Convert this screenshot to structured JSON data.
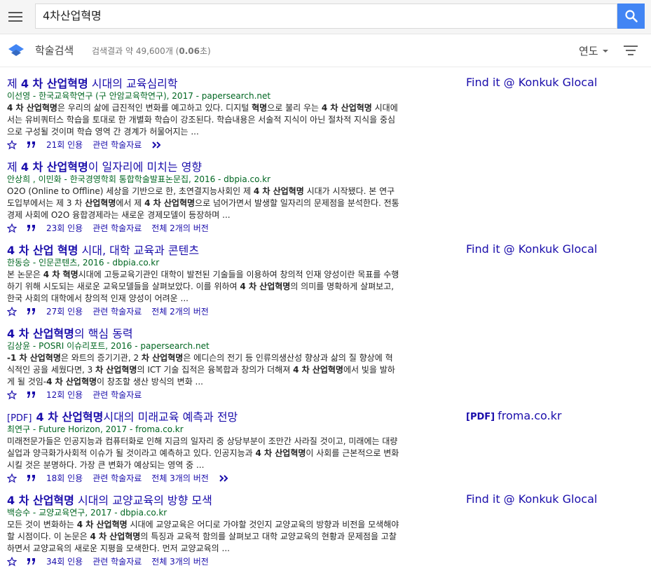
{
  "search": {
    "query": "4차산업혁명"
  },
  "header": {
    "scholar_label": "학술검색",
    "stats": "검색결과 약 49,600개 (0.06초)",
    "stats_pre": "검색결과 약 49,600개 (",
    "stats_time": "0.06",
    "stats_post": "초)",
    "year_label": "연도"
  },
  "results": [
    {
      "pdf_tag": "",
      "title_parts": [
        [
          "제 ",
          false
        ],
        [
          "4 차 산업혁명",
          true
        ],
        [
          " 시대의 교육심리학",
          false
        ]
      ],
      "meta": "이선영 - 한국교육학연구 (구 안암교육학연구), 2017 - papersearch.net",
      "snippet_parts": [
        [
          "4 차 산업혁명",
          true
        ],
        [
          "은 우리의 삶에 급진적인 변화를 예고하고 있다. 디지털 ",
          false
        ],
        [
          "혁명",
          true
        ],
        [
          "으로 불리 우는 ",
          false
        ],
        [
          "4 차 산업혁명",
          true
        ],
        [
          " 시대에서는 유비쿼터스 학습을 토대로 한 개별화 학습이 강조된다. 학습내용은 서술적 지식이 아닌 절차적 지식을 중심으로 구성될 것이며 학습 영역 간 경계가 허물어지는 ...",
          false
        ]
      ],
      "cited": "21회 인용",
      "related": "관련 학술자료",
      "versions": "",
      "more": true,
      "side_pdf": "",
      "side_link": "Find it @ Konkuk Glocal"
    },
    {
      "pdf_tag": "",
      "title_parts": [
        [
          "제 ",
          false
        ],
        [
          "4 차 산업혁명",
          true
        ],
        [
          "이 일자리에 미치는 영향",
          false
        ]
      ],
      "meta": "안상희 , 이민화 - 한국경영학회 통합학술발표논문집, 2016 - dbpia.co.kr",
      "snippet_parts": [
        [
          "O2O (Online to Offline) 세상을 기반으로 한, 초연결지능사회인 제 ",
          false
        ],
        [
          "4 차 산업혁명",
          true
        ],
        [
          " 시대가 시작됐다. 본 연구 도입부에서는 제 3 차 ",
          false
        ],
        [
          "산업혁명",
          true
        ],
        [
          "에서 제 ",
          false
        ],
        [
          "4 차 산업혁명",
          true
        ],
        [
          "으로 넘어가면서 발생할 일자리의 문제점을 분석한다. 전통경제 사회에 O2O 융합경제라는 새로운 경제모델이 등장하며 ...",
          false
        ]
      ],
      "cited": "23회 인용",
      "related": "관련 학술자료",
      "versions": "전체 2개의 버전",
      "more": false,
      "side_pdf": "",
      "side_link": ""
    },
    {
      "pdf_tag": "",
      "title_parts": [
        [
          "4 차 산업 혁명",
          true
        ],
        [
          " 시대, 대학 교육과 콘텐츠",
          false
        ]
      ],
      "meta": "한동승 - 인문콘텐츠, 2016 - dbpia.co.kr",
      "snippet_parts": [
        [
          "본 논문은 ",
          false
        ],
        [
          "4 차 혁명",
          true
        ],
        [
          "시대에 고등교육기관인 대학이 발전된 기술들을 이용하여 창의적 인재 양성이란 목표를 수행하기 위해 시도되는 새로운 교육모델들을 살펴보았다. 이를 위하여 ",
          false
        ],
        [
          "4 차 산업혁명",
          true
        ],
        [
          "의 의미를 명확하게 살펴보고, 한국 사회의 대학에서 창의적 인재 양성이 어려운 ...",
          false
        ]
      ],
      "cited": "27회 인용",
      "related": "관련 학술자료",
      "versions": "전체 2개의 버전",
      "more": false,
      "side_pdf": "",
      "side_link": "Find it @ Konkuk Glocal"
    },
    {
      "pdf_tag": "",
      "title_parts": [
        [
          "4 차 산업혁명",
          true
        ],
        [
          "의 핵심 동력",
          false
        ]
      ],
      "meta": "김상윤 - POSRI 이슈리포트, 2016 - papersearch.net",
      "snippet_parts": [
        [
          "-1 차 산업혁명",
          true
        ],
        [
          "은 와트의 증기기관, 2 ",
          false
        ],
        [
          "차 산업혁명",
          true
        ],
        [
          "은 에디슨의 전기 등 인류의생산성 향상과 삶의 질 향상에 혁식적인 공을 세웠다면, 3 ",
          false
        ],
        [
          "차 산업혁명",
          true
        ],
        [
          "의 ICT 기술 집적은 융복합과 창의가 더해져 ",
          false
        ],
        [
          "4 차 산업혁명",
          true
        ],
        [
          "에서 빛을 발하게 될 것임-",
          false
        ],
        [
          "4 차 산업혁명",
          true
        ],
        [
          "이 창조할 생산 방식의 변화 ...",
          false
        ]
      ],
      "cited": "12회 인용",
      "related": "관련 학술자료",
      "versions": "",
      "more": false,
      "side_pdf": "",
      "side_link": ""
    },
    {
      "pdf_tag": "[PDF]",
      "title_parts": [
        [
          "4 차 산업혁명",
          true
        ],
        [
          "시대의 미래교육 예측과 전망",
          false
        ]
      ],
      "meta": "최연구 - Future Horizon, 2017 - froma.co.kr",
      "snippet_parts": [
        [
          "미래전문가들은 인공지능과 컴퓨터화로 인해 지금의 일자리 중 상당부분이 조만간 사라질 것이고, 미래에는 대량실업과 양극화가사회적 이슈가 될 것이라고 예측하고 있다. 인공지능과 ",
          false
        ],
        [
          "4 차 산업혁명",
          true
        ],
        [
          "이 사회를 근본적으로 변화시킬 것은 분명하다. 가장 큰 변화가 예상되는 영역 중 ...",
          false
        ]
      ],
      "cited": "18회 인용",
      "related": "관련 학술자료",
      "versions": "전체 3개의 버전",
      "more": true,
      "side_pdf": "[PDF]",
      "side_link": "froma.co.kr"
    },
    {
      "pdf_tag": "",
      "title_parts": [
        [
          "4 차 산업혁명",
          true
        ],
        [
          " 시대의 교양교육의 방향 모색",
          false
        ]
      ],
      "meta": "백승수 - 교양교육연구, 2017 - dbpia.co.kr",
      "snippet_parts": [
        [
          "모든 것이 변화하는 ",
          false
        ],
        [
          "4 차 산업혁명",
          true
        ],
        [
          " 시대에 교양교육은 어디로 가야할 것인지 교양교육의 방향과 비전을 모색해야 할 시점이다. 이 논문은 ",
          false
        ],
        [
          "4 차 산업혁명",
          true
        ],
        [
          "의 특징과 교육적 함의를 살펴보고 대학 교양교육의 현황과 문제점을 고찰하면서 교양교육의 새로운 지평을 모색한다. 먼저 교양교육의 ...",
          false
        ]
      ],
      "cited": "34회 인용",
      "related": "관련 학술자료",
      "versions": "전체 3개의 버전",
      "more": false,
      "side_pdf": "",
      "side_link": "Find it @ Konkuk Glocal"
    }
  ]
}
